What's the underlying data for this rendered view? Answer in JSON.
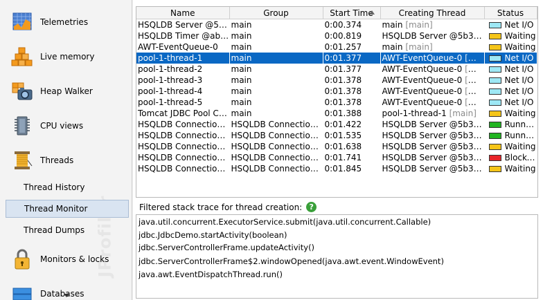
{
  "sidebar": {
    "items": [
      {
        "label": "Telemetries",
        "icon": "telemetries-icon"
      },
      {
        "label": "Live memory",
        "icon": "live-memory-icon"
      },
      {
        "label": "Heap Walker",
        "icon": "heap-walker-icon"
      },
      {
        "label": "CPU views",
        "icon": "cpu-views-icon"
      },
      {
        "label": "Threads",
        "icon": "threads-icon"
      }
    ],
    "sub_items": [
      {
        "label": "Thread History",
        "selected": false
      },
      {
        "label": "Thread Monitor",
        "selected": true
      },
      {
        "label": "Thread Dumps",
        "selected": false
      }
    ],
    "items_after": [
      {
        "label": "Monitors & locks",
        "icon": "lock-icon"
      },
      {
        "label": "Databases",
        "icon": "databases-icon"
      }
    ],
    "watermark": "JProfiler"
  },
  "table": {
    "columns": [
      "Name",
      "Group",
      "Start Time",
      "Creating Thread",
      "Status"
    ],
    "sorted_column": "Start Time",
    "rows": [
      {
        "name": "HSQLDB Server @5b37...",
        "group": "main",
        "start": "0:00.374",
        "creator": "main",
        "creator_group": "[main]",
        "status": "Net I/O",
        "status_color": "#9ee8f5"
      },
      {
        "name": "HSQLDB Timer @ab6b...",
        "group": "main",
        "start": "0:00.819",
        "creator": "HSQLDB Server @5b37e0...",
        "creator_group": "",
        "status": "Waiting",
        "status_color": "#f5c518"
      },
      {
        "name": "AWT-EventQueue-0",
        "group": "main",
        "start": "0:01.257",
        "creator": "main",
        "creator_group": "[main]",
        "status": "Waiting",
        "status_color": "#f5c518"
      },
      {
        "name": "pool-1-thread-1",
        "group": "main",
        "start": "0:01.377",
        "creator": "AWT-EventQueue-0",
        "creator_group": "[main]",
        "status": "Net I/O",
        "status_color": "#9ee8f5",
        "selected": true
      },
      {
        "name": "pool-1-thread-2",
        "group": "main",
        "start": "0:01.377",
        "creator": "AWT-EventQueue-0",
        "creator_group": "[main]",
        "status": "Net I/O",
        "status_color": "#9ee8f5"
      },
      {
        "name": "pool-1-thread-3",
        "group": "main",
        "start": "0:01.378",
        "creator": "AWT-EventQueue-0",
        "creator_group": "[main]",
        "status": "Net I/O",
        "status_color": "#9ee8f5"
      },
      {
        "name": "pool-1-thread-4",
        "group": "main",
        "start": "0:01.378",
        "creator": "AWT-EventQueue-0",
        "creator_group": "[main]",
        "status": "Net I/O",
        "status_color": "#9ee8f5"
      },
      {
        "name": "pool-1-thread-5",
        "group": "main",
        "start": "0:01.378",
        "creator": "AWT-EventQueue-0",
        "creator_group": "[main]",
        "status": "Net I/O",
        "status_color": "#9ee8f5"
      },
      {
        "name": "Tomcat JDBC Pool Clea...",
        "group": "main",
        "start": "0:01.388",
        "creator": "pool-1-thread-1",
        "creator_group": "[main]",
        "status": "Waiting",
        "status_color": "#f5c518"
      },
      {
        "name": "HSQLDB Connection ...",
        "group": "HSQLDB Connections ...",
        "start": "0:01.422",
        "creator": "HSQLDB Server @5b37e0...",
        "creator_group": "",
        "status": "Runnable",
        "status_color": "#22b522"
      },
      {
        "name": "HSQLDB Connection ...",
        "group": "HSQLDB Connections ...",
        "start": "0:01.535",
        "creator": "HSQLDB Server @5b37e0...",
        "creator_group": "",
        "status": "Runnable",
        "status_color": "#22b522"
      },
      {
        "name": "HSQLDB Connection ...",
        "group": "HSQLDB Connections ...",
        "start": "0:01.638",
        "creator": "HSQLDB Server @5b37e0...",
        "creator_group": "",
        "status": "Waiting",
        "status_color": "#f5c518"
      },
      {
        "name": "HSQLDB Connection ...",
        "group": "HSQLDB Connections ...",
        "start": "0:01.741",
        "creator": "HSQLDB Server @5b37e0...",
        "creator_group": "",
        "status": "Blocked",
        "status_color": "#e8242a"
      },
      {
        "name": "HSQLDB Connection ...",
        "group": "HSQLDB Connections ...",
        "start": "0:01.845",
        "creator": "HSQLDB Server @5b37e0...",
        "creator_group": "",
        "status": "Waiting",
        "status_color": "#f5c518"
      }
    ]
  },
  "filter_label": "Filtered stack trace for thread creation:",
  "help_symbol": "?",
  "stack_trace": [
    "java.util.concurrent.ExecutorService.submit(java.util.concurrent.Callable)",
    "jdbc.JdbcDemo.startActivity(boolean)",
    "jdbc.ServerControllerFrame.updateActivity()",
    "jdbc.ServerControllerFrame$2.windowOpened(java.awt.event.WindowEvent)",
    "java.awt.EventDispatchThread.run()"
  ]
}
